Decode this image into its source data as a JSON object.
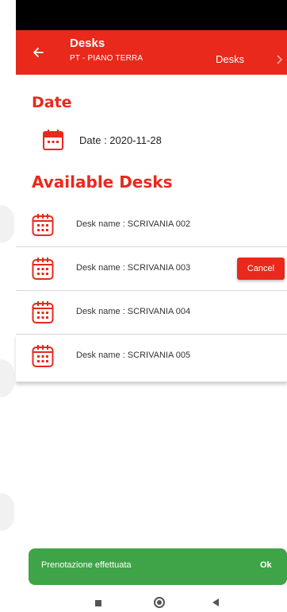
{
  "app_bar": {
    "title": "Desks",
    "subtitle": "PT - PIANO TERRA",
    "action": "Desks"
  },
  "date_section": {
    "title": "Date",
    "label": "Date :  2020-11-28"
  },
  "desks_section": {
    "title": "Available Desks",
    "items": [
      {
        "label": "Desk name : SCRIVANIA 002"
      },
      {
        "label": "Desk name : SCRIVANIA 003",
        "action": "Cancel"
      },
      {
        "label": "Desk name : SCRIVANIA 004"
      },
      {
        "label": "Desk name : SCRIVANIA 005"
      }
    ]
  },
  "snackbar": {
    "message": "Prenotazione effettuata",
    "action": "Ok"
  },
  "colors": {
    "primary": "#e8291c",
    "snackbar": "#3fa348"
  },
  "icons": {
    "back": "arrow-left-icon",
    "calendar": "calendar-icon"
  }
}
